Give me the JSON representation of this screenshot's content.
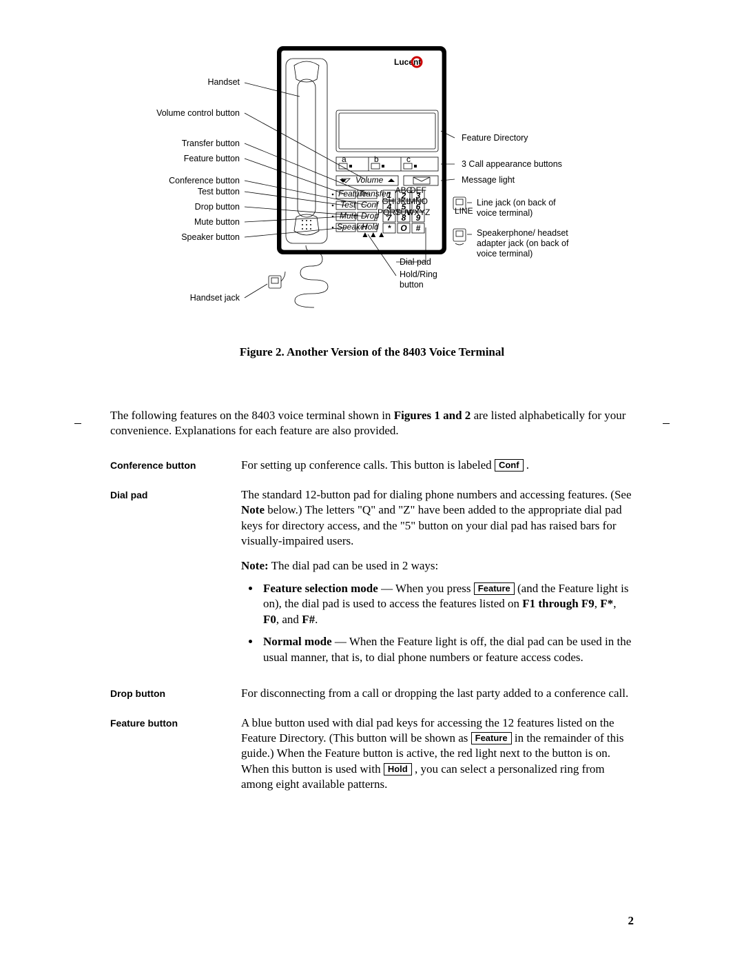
{
  "figure": {
    "caption": "Figure 2.  Another Version of the 8403 Voice Terminal",
    "brand": "Lucent",
    "left_labels": [
      "Handset",
      "Volume control button",
      "Transfer button",
      "Feature button",
      "Conference button",
      "Test button",
      "Drop button",
      "Mute button",
      "Speaker button",
      "Handset jack"
    ],
    "right_labels": [
      "Feature Directory",
      "3 Call appearance buttons",
      "Message light",
      "Line jack (on back of voice terminal)",
      "Speakerphone/ headset adapter jack (on back of voice terminal)",
      "Dial pad",
      "Hold/Ring button"
    ],
    "line_letters": [
      "a",
      "b",
      "c"
    ],
    "keypad": {
      "rows": [
        [
          "1",
          "2",
          "3"
        ],
        [
          "4",
          "5",
          "6"
        ],
        [
          "7",
          "8",
          "9"
        ],
        [
          "*",
          "O",
          "#"
        ]
      ],
      "row_letters": [
        [
          "",
          "ABC",
          "DEF"
        ],
        [
          "GHI",
          "JKL",
          "MNO"
        ],
        [
          "PQRS",
          "TUV",
          "WXYZ"
        ],
        [
          "",
          "",
          ""
        ]
      ]
    },
    "fn_buttons_r1": [
      "Feature",
      "Transfer"
    ],
    "fn_buttons_r2": [
      "Test",
      "Conf"
    ],
    "fn_buttons_r3": [
      "Mute",
      "Drop"
    ],
    "fn_buttons_r4": [
      "Speaker",
      "Hold"
    ],
    "volume_label": "Volume",
    "line_jack_label": "LINE"
  },
  "intro": {
    "lead1": "The following features on the 8403 voice terminal shown in ",
    "lead_bold": "Figures 1 and 2",
    "lead2": " are listed alphabetically for your convenience. Explanations for each feature are also provided."
  },
  "features": {
    "conference": {
      "name": "Conference button",
      "text1": "For setting up conference calls. This button is labeled ",
      "key": "Conf",
      "text2": " ."
    },
    "dialpad": {
      "name": "Dial pad",
      "p1a": "The standard 12-button pad for dialing phone numbers and accessing features. (See ",
      "p1_bold1": "Note",
      "p1b": " below.) The letters \"Q\" and \"Z\" have been added to the appropriate dial pad keys for directory access, and the \"5\" button on your dial pad has raised bars for visually-impaired users.",
      "note_bold": "Note:",
      "note_text": "  The dial pad can be used in 2 ways:",
      "bullet1_bold": "Feature selection mode",
      "bullet1_a": " — When you press ",
      "bullet1_key": "Feature",
      "bullet1_b": "  (and the Feature light is on), the dial pad is used to access the features listed on ",
      "bullet1_bold2": "F1 through F9",
      "bullet1_c": ", ",
      "bullet1_bold3": "F*",
      "bullet1_d": ", ",
      "bullet1_bold4": "F0",
      "bullet1_e": ", and ",
      "bullet1_bold5": "F#",
      "bullet1_f": ".",
      "bullet2_bold": "Normal mode",
      "bullet2_text": " — When the Feature light is off, the dial pad can be used in the usual manner, that is, to dial phone numbers or feature access codes."
    },
    "drop": {
      "name": "Drop button",
      "text": "For disconnecting from a call or dropping the last party added to a conference call."
    },
    "feature": {
      "name": "Feature button",
      "t1": "A blue button used with dial pad keys for accessing the 12 features listed on the Feature Directory. (This button will be shown as ",
      "key1": "Feature",
      "t2": " in the remainder of this guide.) When the Feature button is active, the red light next to the button is on. When this button is used with ",
      "key2": "Hold",
      "t3": " , you can select a personalized ring from among eight available patterns."
    }
  },
  "page_number": "2"
}
